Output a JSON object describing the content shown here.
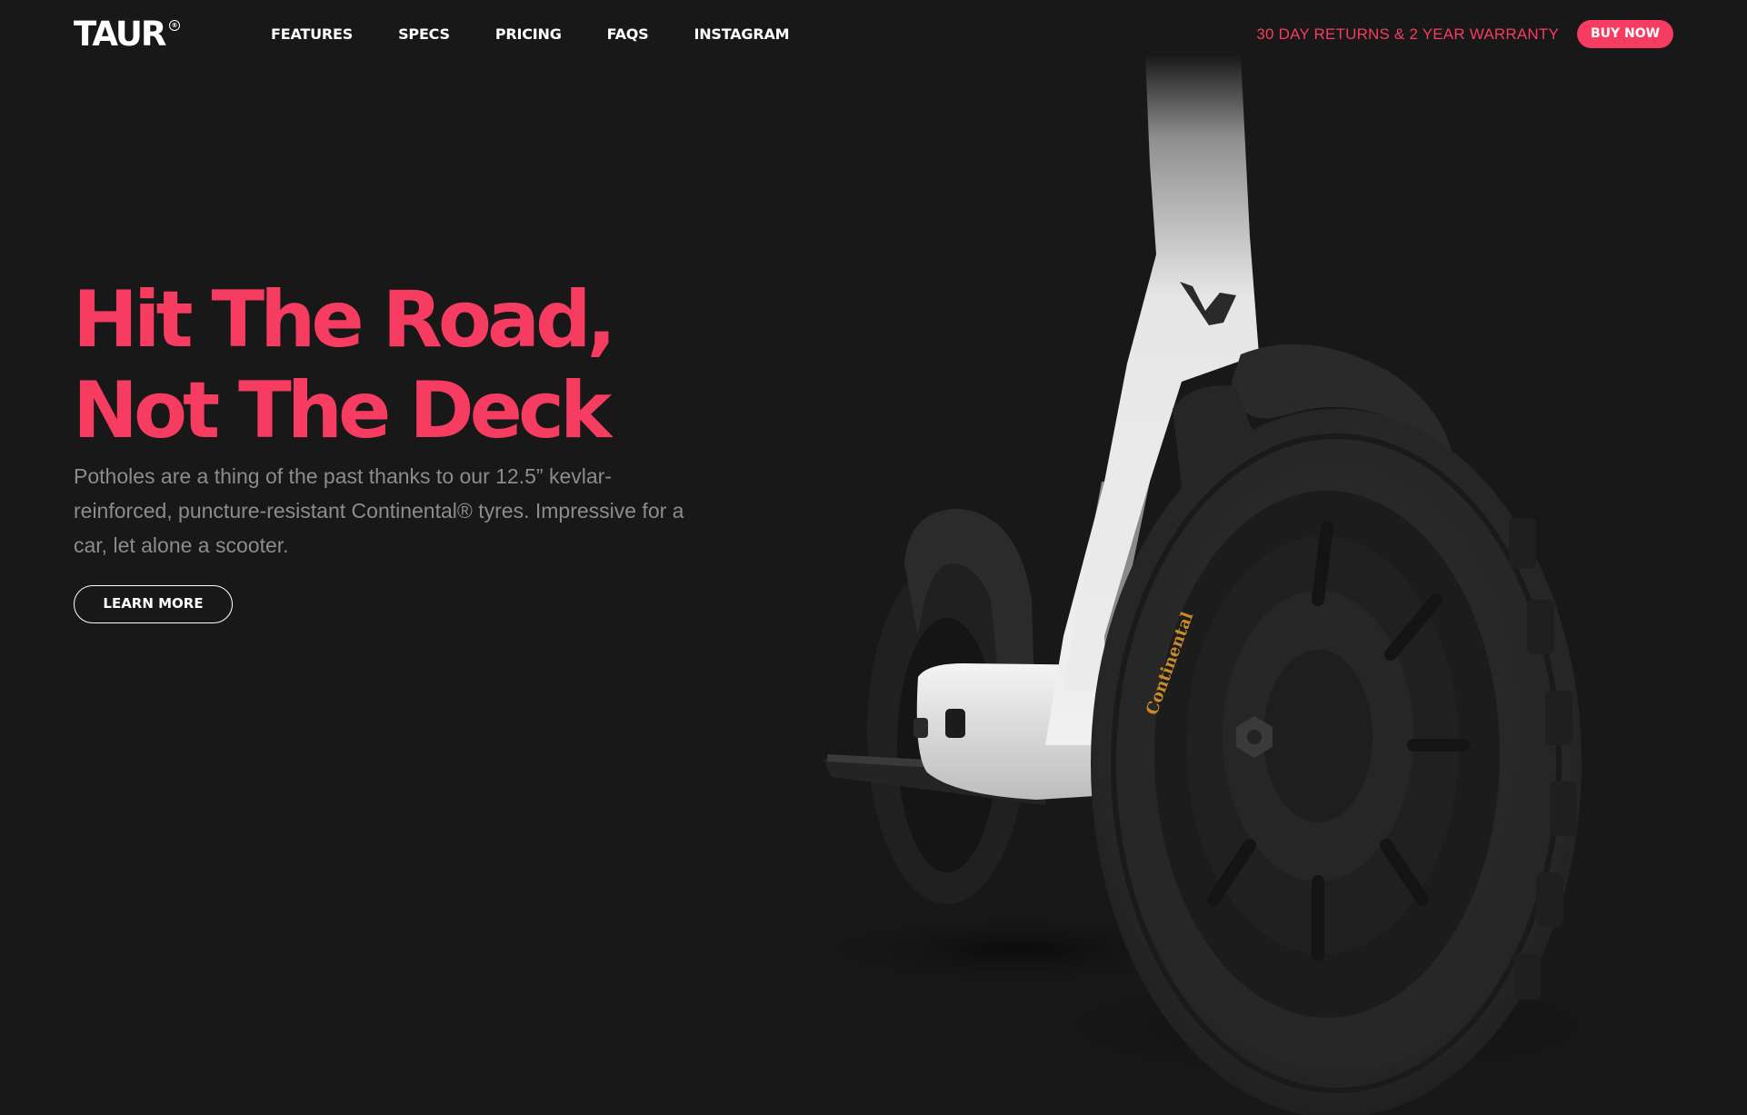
{
  "brand": {
    "name": "TAUR",
    "mark": "®"
  },
  "nav": {
    "items": [
      {
        "label": "FEATURES"
      },
      {
        "label": "SPECS"
      },
      {
        "label": "PRICING"
      },
      {
        "label": "FAQS"
      },
      {
        "label": "INSTAGRAM"
      }
    ]
  },
  "header": {
    "warranty": "30 DAY RETURNS & 2 YEAR WARRANTY",
    "buy_label": "BUY NOW"
  },
  "hero": {
    "title_line1": "Hit The Road,",
    "title_line2": "Not The Deck",
    "description": "Potholes are a thing of the past thanks to our 12.5” kevlar-reinforced, puncture-resistant Continental® tyres. Impressive for a car, let alone a scooter.",
    "cta_label": "LEARN MORE",
    "tyre_brand": "Continental"
  },
  "colors": {
    "background": "#181818",
    "accent": "#f63c61",
    "body_text": "#8c8c8c"
  }
}
